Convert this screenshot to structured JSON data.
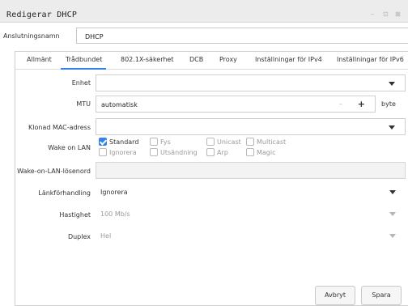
{
  "window": {
    "title": "Redigerar DHCP",
    "minimize_glyph": "–",
    "maximize_glyph": "⊡",
    "close_glyph": "⊠"
  },
  "connection": {
    "label": "Anslutningsnamn",
    "value": "DHCP"
  },
  "tabs": [
    {
      "label": "Allmänt",
      "active": false
    },
    {
      "label": "Trådbundet",
      "active": true
    },
    {
      "label": "802.1X-säkerhet",
      "active": false
    },
    {
      "label": "DCB",
      "active": false
    },
    {
      "label": "Proxy",
      "active": false
    },
    {
      "label": "Inställningar för IPv4",
      "active": false
    },
    {
      "label": "Inställningar för IPv6",
      "active": false
    }
  ],
  "wired": {
    "device_label": "Enhet",
    "device_value": "",
    "cloned_mac_label": "Klonad MAC-adress",
    "cloned_mac_value": "",
    "mtu_label": "MTU",
    "mtu_value": "automatisk",
    "mtu_minus": "–",
    "mtu_plus": "+",
    "mtu_unit": "byte",
    "wol_label": "Wake on LAN",
    "wol_options": [
      {
        "label": "Standard",
        "checked": true,
        "enabled": true
      },
      {
        "label": "Fys",
        "checked": false,
        "enabled": false
      },
      {
        "label": "Unicast",
        "checked": false,
        "enabled": false
      },
      {
        "label": "Multicast",
        "checked": false,
        "enabled": false
      },
      {
        "label": "Ignorera",
        "checked": false,
        "enabled": false
      },
      {
        "label": "Utsändning",
        "checked": false,
        "enabled": false
      },
      {
        "label": "Arp",
        "checked": false,
        "enabled": false
      },
      {
        "label": "Magic",
        "checked": false,
        "enabled": false
      }
    ],
    "wol_password_label": "Wake-on-LAN-lösenord",
    "wol_password_value": "",
    "link_negotiation_label": "Länkförhandling",
    "link_negotiation_value": "Ignorera",
    "speed_label": "Hastighet",
    "speed_value": "100 Mb/s",
    "duplex_label": "Duplex",
    "duplex_value": "Hel"
  },
  "footer": {
    "cancel_label": "Avbryt",
    "save_label": "Spara"
  },
  "colors": {
    "accent": "#3584e4",
    "titlebar_bg": "#ececec",
    "disabled_text": "#9a9a9a"
  }
}
